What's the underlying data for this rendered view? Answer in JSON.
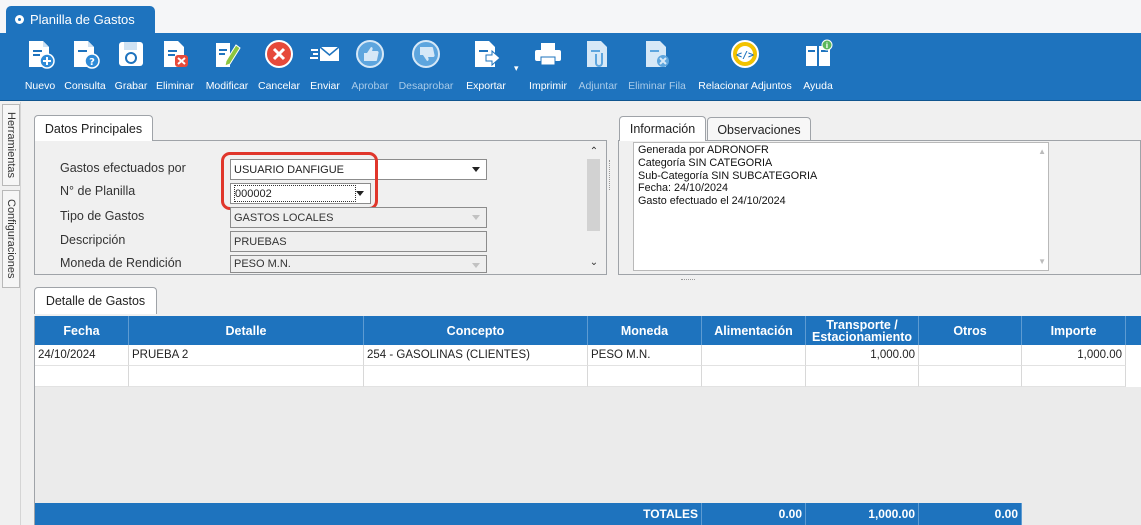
{
  "window": {
    "title": "Planilla de Gastos"
  },
  "toolbar": {
    "items": [
      {
        "label": "Nuevo",
        "icon": "new-doc-icon",
        "enabled": true
      },
      {
        "label": "Consulta",
        "icon": "query-doc-icon",
        "enabled": true
      },
      {
        "label": "Grabar",
        "icon": "save-icon",
        "enabled": true
      },
      {
        "label": "Eliminar",
        "icon": "delete-doc-icon",
        "enabled": true
      },
      {
        "label": "Modificar",
        "icon": "edit-icon",
        "enabled": true
      },
      {
        "label": "Cancelar",
        "icon": "cancel-icon",
        "enabled": true
      },
      {
        "label": "Enviar",
        "icon": "send-mail-icon",
        "enabled": true
      },
      {
        "label": "Aprobar",
        "icon": "thumbs-up-icon",
        "enabled": false
      },
      {
        "label": "Desaprobar",
        "icon": "thumbs-down-icon",
        "enabled": false
      },
      {
        "label": "Exportar",
        "icon": "export-icon",
        "enabled": true
      },
      {
        "label": "Imprimir",
        "icon": "printer-icon",
        "enabled": true
      },
      {
        "label": "Adjuntar",
        "icon": "attach-icon",
        "enabled": false
      },
      {
        "label": "Eliminar Fila",
        "icon": "delete-row-icon",
        "enabled": false
      },
      {
        "label": "Relacionar Adjuntos",
        "icon": "link-attachments-icon",
        "enabled": true
      },
      {
        "label": "Ayuda",
        "icon": "help-book-icon",
        "enabled": true
      }
    ]
  },
  "side_tabs": [
    "Herramientas",
    "Configuraciones"
  ],
  "datos": {
    "tab": "Datos Principales",
    "fields": [
      {
        "label": "Gastos efectuados por",
        "value": "USUARIO DANFIGUE"
      },
      {
        "label": "N° de Planilla",
        "value": "000002"
      },
      {
        "label": "Tipo de Gastos",
        "value": "GASTOS LOCALES"
      },
      {
        "label": "Descripción",
        "value": "PRUEBAS"
      },
      {
        "label": "Moneda de Rendición",
        "value": "PESO M.N."
      }
    ]
  },
  "info": {
    "tabs": [
      "Información",
      "Observaciones"
    ],
    "lines": [
      "Generada por ADRONOFR",
      "Categoría SIN CATEGORIA",
      "Sub-Categoría SIN SUBCATEGORIA",
      "Fecha: 24/10/2024",
      "Gasto efectuado el 24/10/2024"
    ]
  },
  "detalle": {
    "tab": "Detalle de Gastos",
    "columns": [
      "Fecha",
      "Detalle",
      "Concepto",
      "Moneda",
      "Alimentación",
      "Transporte / Estacionamiento",
      "Otros",
      "Importe"
    ],
    "rows": [
      {
        "fecha": "24/10/2024",
        "detalle": "PRUEBA 2",
        "concepto": "254 - GASOLINAS (CLIENTES)",
        "moneda": "PESO M.N.",
        "alimentacion": "",
        "transporte": "1,000.00",
        "otros": "",
        "importe": "1,000.00"
      }
    ],
    "totals": {
      "label": "TOTALES",
      "alimentacion": "0.00",
      "transporte": "1,000.00",
      "otros": "0.00"
    }
  },
  "colors": {
    "accent": "#1e73be",
    "highlight": "#e0362b"
  }
}
